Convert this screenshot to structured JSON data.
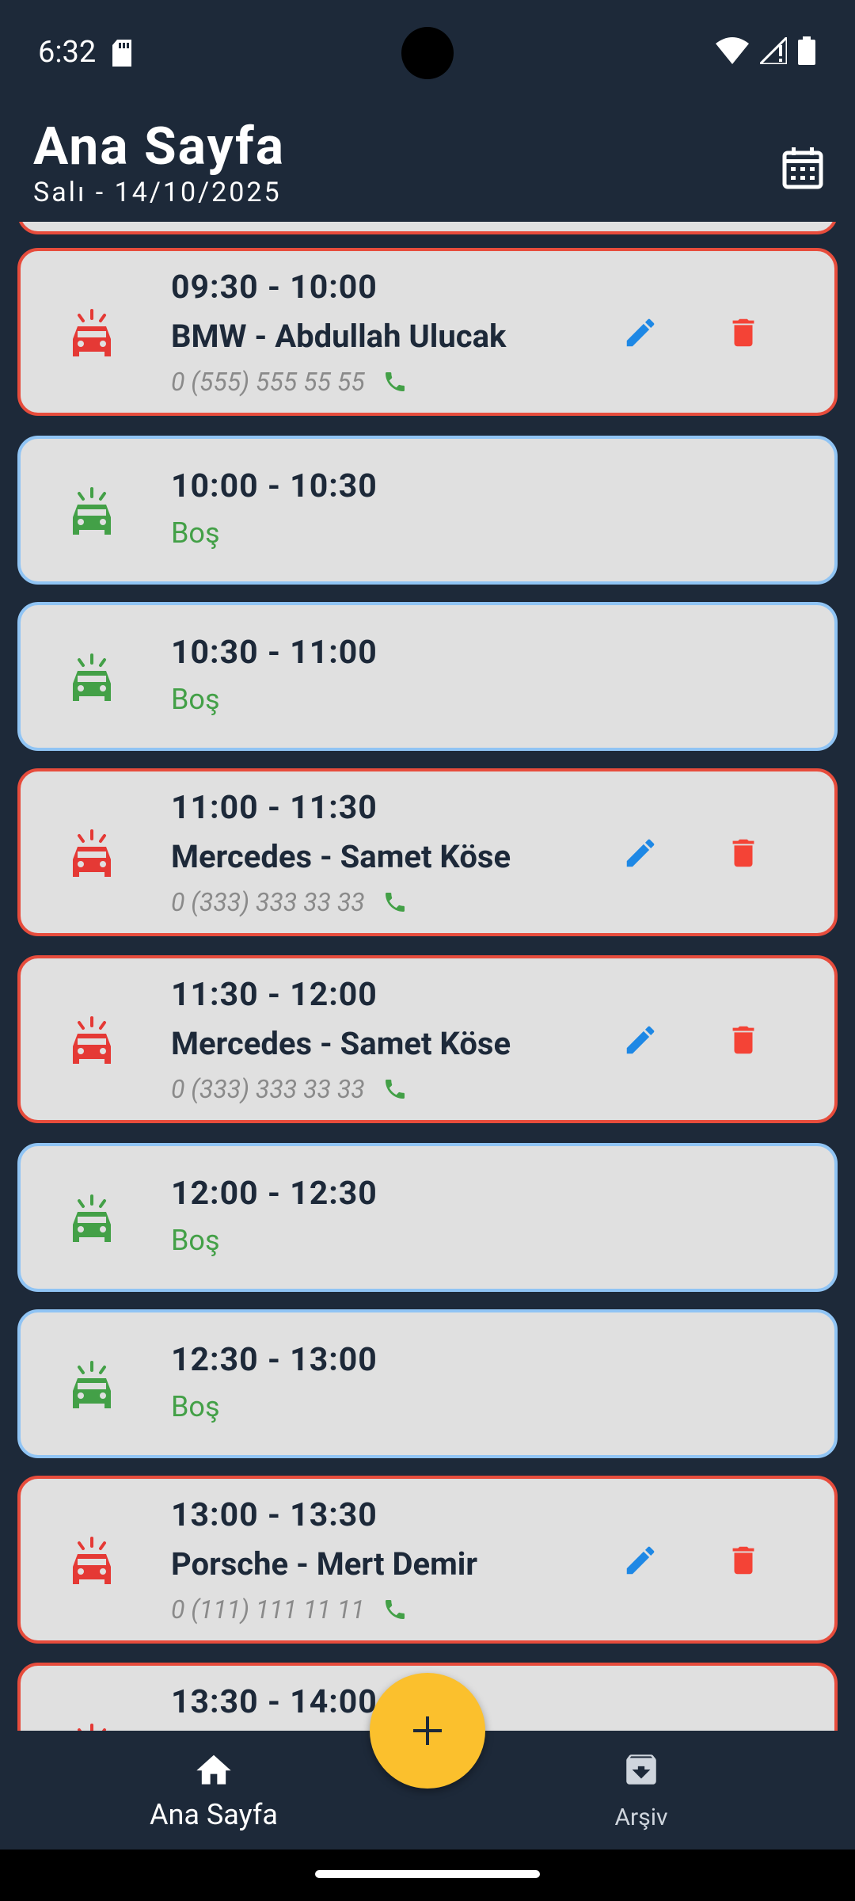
{
  "status_bar": {
    "time": "6:32"
  },
  "header": {
    "title": "Ana Sayfa",
    "subtitle": "Salı  -  14/10/2025"
  },
  "colors": {
    "busy": "#e53935",
    "free": "#43a047",
    "accent": "#fbc02d",
    "edit": "#1e88e5",
    "background": "#1d2939"
  },
  "appointments": [
    {
      "time": "09:30 - 10:00",
      "name": "BMW - Abdullah Ulucak",
      "phone": "0 (555) 555 55 55"
    },
    {
      "time": "10:00 - 10:30",
      "status": "Boş"
    },
    {
      "time": "10:30 - 11:00",
      "status": "Boş"
    },
    {
      "time": "11:00 - 11:30",
      "name": "Mercedes - Samet Köse",
      "phone": "0 (333) 333 33 33"
    },
    {
      "time": "11:30 - 12:00",
      "name": "Mercedes - Samet Köse",
      "phone": "0 (333) 333 33 33"
    },
    {
      "time": "12:00 - 12:30",
      "status": "Boş"
    },
    {
      "time": "12:30 - 13:00",
      "status": "Boş"
    },
    {
      "time": "13:00 - 13:30",
      "name": "Porsche - Mert Demir",
      "phone": "0 (111) 111 11 11"
    },
    {
      "time": "13:30 - 14:00"
    }
  ],
  "bottom_nav": {
    "home_label": "Ana Sayfa",
    "archive_label": "Arşiv"
  }
}
